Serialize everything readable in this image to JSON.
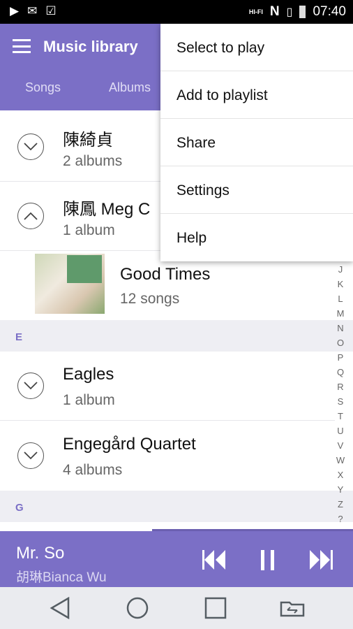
{
  "status_bar": {
    "time": "07:40",
    "left_icons": [
      "play-icon",
      "gmail-icon",
      "clipboard-check-icon"
    ],
    "right_icons": [
      "hifi-icon",
      "nfc-icon",
      "no-sim-icon",
      "battery-icon"
    ],
    "hifi": "HI-FI"
  },
  "header": {
    "title": "Music library",
    "tabs": [
      {
        "label": "Songs"
      },
      {
        "label": "Albums"
      }
    ]
  },
  "list": {
    "rows": [
      {
        "name": "陳綺貞",
        "sub": "2 albums",
        "expanded": false
      },
      {
        "name": "陳鳳 Meg C",
        "sub": "1 album",
        "expanded": true
      }
    ],
    "album": {
      "title": "Good Times",
      "sub": "12 songs"
    },
    "section_e": "E",
    "rows_e": [
      {
        "name": "Eagles",
        "sub": "1 album",
        "expanded": false
      },
      {
        "name": "Engegård Quartet",
        "sub": "4 albums",
        "expanded": false
      }
    ],
    "section_g": "G"
  },
  "index_letters": [
    "J",
    "K",
    "L",
    "M",
    "N",
    "O",
    "P",
    "Q",
    "R",
    "S",
    "T",
    "U",
    "V",
    "W",
    "X",
    "Y",
    "Z",
    "?"
  ],
  "overflow_menu": {
    "items": [
      {
        "label": "Select to play"
      },
      {
        "label": "Add to playlist"
      },
      {
        "label": "Share"
      },
      {
        "label": "Settings"
      },
      {
        "label": "Help"
      }
    ]
  },
  "player": {
    "title": "Mr. So",
    "artist": "胡琳Bianca Wu",
    "progress_percent": 43,
    "state": "playing"
  },
  "colors": {
    "accent": "#7b6fc6",
    "section_bg": "#eeeef3"
  }
}
